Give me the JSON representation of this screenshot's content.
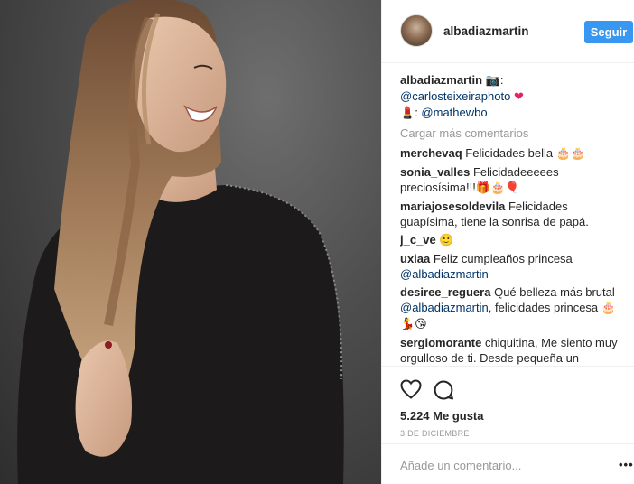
{
  "post": {
    "photo_icon": "photo-of-woman-smiling"
  },
  "header": {
    "username": "albadiazmartin",
    "follow_label": "Seguir"
  },
  "caption": {
    "user": "albadiazmartin",
    "camera_emoji": "📷",
    "line1_mention": "@carlosteixeiraphoto",
    "heart_emoji": "❤",
    "lipstick_emoji": "💄",
    "line2_prefix": ": ",
    "line2_mention": "@mathewbo"
  },
  "load_more": "Cargar más comentarios",
  "comments": [
    {
      "user": "merchevaq",
      "text": "Felicidades bella",
      "emoji": "🎂🎂",
      "mention": ""
    },
    {
      "user": "sonia_valles",
      "text": "Felicidadeeeees preciosísima!!!",
      "emoji": "🎁🎂🎈",
      "mention": ""
    },
    {
      "user": "mariajosesoldevila",
      "text": "Felicidades guapísima, tiene la sonrisa de papá.",
      "emoji": "",
      "mention": ""
    },
    {
      "user": "j_c_ve",
      "text": "",
      "emoji": "🙂",
      "mention": ""
    },
    {
      "user": "uxiaa",
      "text": "Feliz cumpleaños princesa",
      "emoji": "",
      "mention": "@albadiazmartin"
    },
    {
      "user": "desiree_reguera",
      "text": "Qué belleza más brutal",
      "emoji": "🎂💃😘",
      "mention": "@albadiazmartin",
      "after": ", felicidades princesa"
    },
    {
      "user": "sergiomorante",
      "text": "chiquitina, Me siento muy orgulloso de ti. Desde pequeña un",
      "emoji": "",
      "mention": ""
    }
  ],
  "actions": {
    "like_icon": "heart-icon",
    "comment_icon": "comment-icon",
    "likes": "5.224 Me gusta",
    "date": "3 DE DICIEMBRE"
  },
  "add_comment": {
    "placeholder": "Añade un comentario...",
    "more": "•••"
  }
}
